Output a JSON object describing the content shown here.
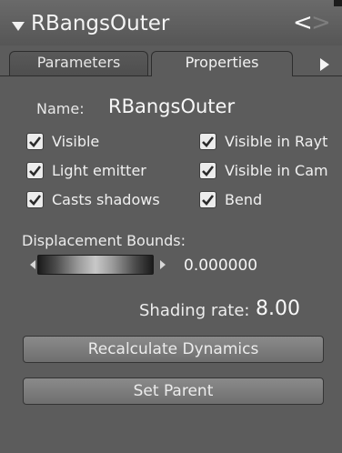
{
  "window": {
    "title": "RBangsOuter",
    "nav_prev": "<",
    "nav_next": ">"
  },
  "tabs": [
    {
      "label": "Parameters",
      "active": false
    },
    {
      "label": "Properties",
      "active": true
    }
  ],
  "properties": {
    "name_label": "Name:",
    "name_value": "RBangsOuter",
    "checkboxes": [
      {
        "label": "Visible",
        "checked": true
      },
      {
        "label": "Visible in Rayt",
        "checked": true
      },
      {
        "label": "Light emitter",
        "checked": true
      },
      {
        "label": "Visible in Cam",
        "checked": true
      },
      {
        "label": "Casts shadows",
        "checked": true
      },
      {
        "label": "Bend",
        "checked": true
      }
    ],
    "displacement_label": "Displacement Bounds:",
    "displacement_value": "0.000000",
    "shading_rate_label": "Shading rate:",
    "shading_rate_value": "8.00"
  },
  "buttons": {
    "recalculate": "Recalculate Dynamics",
    "set_parent": "Set Parent"
  },
  "colors": {
    "panel_bg": "#5c5c5c",
    "checkbox_bg": "#ececec",
    "checkmark": "#2a2a2a",
    "button_bg": "#7d7d7d"
  }
}
